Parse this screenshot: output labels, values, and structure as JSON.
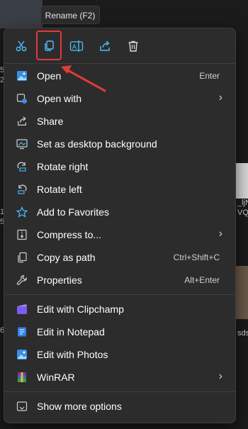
{
  "tooltip": {
    "text": "Rename (F2)"
  },
  "toolbar": {
    "cut": "cut-icon",
    "copy": "copy-icon",
    "rename": "rename-icon",
    "share": "share-icon",
    "delete": "delete-icon"
  },
  "menu": {
    "items": [
      {
        "label": "Open",
        "shortcut": "Enter",
        "icon": "photos-icon"
      },
      {
        "label": "Open with",
        "shortcut": "",
        "icon": "open-with-icon",
        "submenu": true
      },
      {
        "label": "Share",
        "shortcut": "",
        "icon": "share-icon"
      },
      {
        "label": "Set as desktop background",
        "shortcut": "",
        "icon": "desktop-icon"
      },
      {
        "label": "Rotate right",
        "shortcut": "",
        "icon": "rotate-right-icon"
      },
      {
        "label": "Rotate left",
        "shortcut": "",
        "icon": "rotate-left-icon"
      },
      {
        "label": "Add to Favorites",
        "shortcut": "",
        "icon": "star-icon"
      },
      {
        "label": "Compress to...",
        "shortcut": "",
        "icon": "zip-icon",
        "submenu": true
      },
      {
        "label": "Copy as path",
        "shortcut": "Ctrl+Shift+C",
        "icon": "copy-path-icon"
      },
      {
        "label": "Properties",
        "shortcut": "Alt+Enter",
        "icon": "wrench-icon"
      },
      {
        "label": "Edit with Clipchamp",
        "shortcut": "",
        "icon": "clipchamp-icon"
      },
      {
        "label": "Edit in Notepad",
        "shortcut": "",
        "icon": "notepad-icon"
      },
      {
        "label": "Edit with Photos",
        "shortcut": "",
        "icon": "photos-icon"
      },
      {
        "label": "WinRAR",
        "shortcut": "",
        "icon": "winrar-icon",
        "submenu": true
      },
      {
        "label": "Show more options",
        "shortcut": "",
        "icon": "more-options-icon"
      }
    ]
  },
  "background": {
    "fragments": [
      "5",
      "2",
      "1",
      "5",
      "_ljN",
      "VQ",
      "sds",
      "6"
    ]
  },
  "colors": {
    "accent": "#4cc2ff",
    "highlight": "#e23b3b",
    "menu_bg": "#2c2c2c"
  }
}
